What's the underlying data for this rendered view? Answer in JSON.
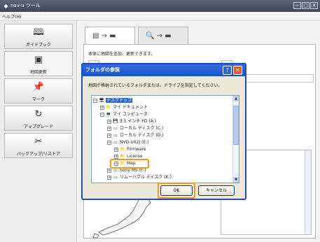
{
  "window": {
    "title": "nav-u ツール"
  },
  "menubar": {
    "help": "ヘルプ(H)"
  },
  "sidebar": {
    "items": [
      {
        "label": "ガイドブック",
        "icon": "book-icon"
      },
      {
        "label": "地図更新",
        "icon": "map-update-icon"
      },
      {
        "label": "マーク",
        "icon": "pin-icon"
      },
      {
        "label": "アップグレード",
        "icon": "refresh-icon"
      },
      {
        "label": "バックアップ/リストア",
        "icon": "tools-icon"
      }
    ]
  },
  "main": {
    "tabs": [
      {
        "glyphs": "▤ → ▬",
        "name": "update"
      },
      {
        "glyphs": "🔍 → ▬",
        "name": "search"
      }
    ],
    "description": "本体に地図を追加、更新できます。"
  },
  "dialog": {
    "title": "フォルダの参照",
    "help_button": "?",
    "close_button": "✕",
    "message": "地図が格納されているフォルダまたは、ドライブを指定してください。",
    "tree": [
      {
        "label": "デスクトップ",
        "icon": "desktop-icon",
        "glyph": "🖥",
        "expander": "−",
        "level": 0,
        "selected": true
      },
      {
        "label": "マイ ドキュメント",
        "icon": "folder-icon",
        "glyph": "📁",
        "expander": "+",
        "level": 1
      },
      {
        "label": "マイ コンピュータ",
        "icon": "computer-icon",
        "glyph": "💻",
        "expander": "−",
        "level": 1
      },
      {
        "label": "3.5 インチ FD (A:)",
        "icon": "floppy-icon",
        "glyph": "💾",
        "expander": "+",
        "level": 2
      },
      {
        "label": "ローカル ディスク (C:)",
        "icon": "drive-icon",
        "glyph": "▭",
        "expander": "+",
        "level": 2
      },
      {
        "label": "ローカル ディスク (D:)",
        "icon": "drive-icon",
        "glyph": "▭",
        "expander": "+",
        "level": 2
      },
      {
        "label": "NVD-U02J (E:)",
        "icon": "usb-drive-icon",
        "glyph": "▭",
        "expander": "−",
        "level": 2
      },
      {
        "label": "Firmware",
        "icon": "folder-icon",
        "glyph": "📁",
        "expander": "+",
        "level": 3
      },
      {
        "label": "License",
        "icon": "folder-icon",
        "glyph": "📁",
        "expander": "+",
        "level": 3
      },
      {
        "label": "Map",
        "icon": "folder-icon",
        "glyph": "📁",
        "expander": "+",
        "level": 3
      },
      {
        "label": "Sony MS (F:)",
        "icon": "drive-icon",
        "glyph": "▭",
        "expander": "+",
        "level": 2
      },
      {
        "label": "リムーバブル ディスク (K:)",
        "icon": "drive-icon",
        "glyph": "▭",
        "expander": "+",
        "level": 2
      }
    ],
    "ok_label": "OK",
    "cancel_label": "キャンセル"
  },
  "colors": {
    "highlight": "#f39a1a",
    "dialog_title": "#1a52c8",
    "selection": "#316ac5"
  }
}
